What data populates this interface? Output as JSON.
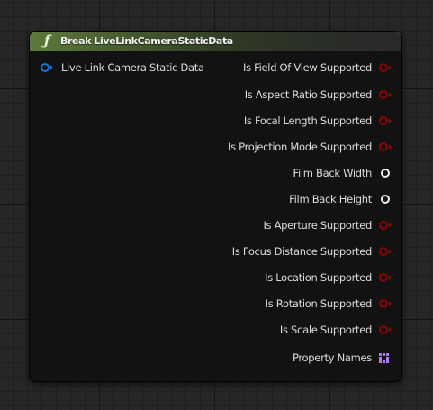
{
  "node": {
    "title": "Break LiveLinkCameraStaticData",
    "icon": "function-icon",
    "header_color": "#5c7a3b",
    "input_pins": [
      {
        "label": "Live Link Camera Static Data",
        "type": "struct",
        "color": "#1e6fd0"
      }
    ],
    "output_pins": [
      {
        "label": "Is Field Of View Supported",
        "type": "bool",
        "color": "#930000"
      },
      {
        "label": "Is Aspect Ratio Supported",
        "type": "bool",
        "color": "#930000"
      },
      {
        "label": "Is Focal Length Supported",
        "type": "bool",
        "color": "#930000"
      },
      {
        "label": "Is Projection Mode Supported",
        "type": "bool",
        "color": "#930000"
      },
      {
        "label": "Film Back Width",
        "type": "float",
        "color": "#ffffff"
      },
      {
        "label": "Film Back Height",
        "type": "float",
        "color": "#ffffff"
      },
      {
        "label": "Is Aperture Supported",
        "type": "bool",
        "color": "#930000"
      },
      {
        "label": "Is Focus Distance Supported",
        "type": "bool",
        "color": "#930000"
      },
      {
        "label": "Is Location Supported",
        "type": "bool",
        "color": "#930000"
      },
      {
        "label": "Is Rotation Supported",
        "type": "bool",
        "color": "#930000"
      },
      {
        "label": "Is Scale Supported",
        "type": "bool",
        "color": "#930000"
      },
      {
        "label": "Property Names",
        "type": "name-array",
        "color": "#b07cf0"
      }
    ]
  }
}
